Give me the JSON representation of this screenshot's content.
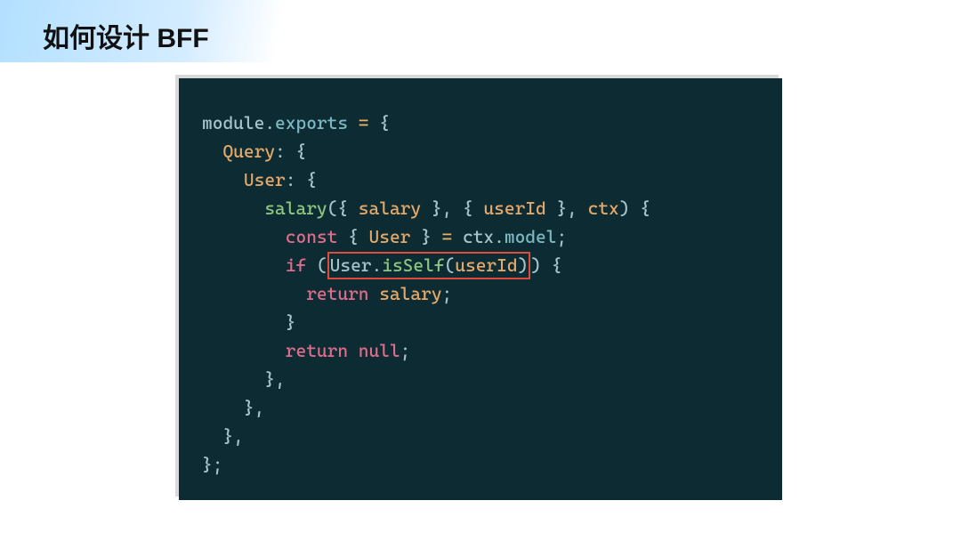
{
  "header": {
    "title_prefix": "如何设计 ",
    "title_bold": "BFF"
  },
  "code": {
    "lines": [
      {
        "indent": 0,
        "segments": [
          {
            "t": "module",
            "c": "tok-obj"
          },
          {
            "t": ".",
            "c": "tok-obj"
          },
          {
            "t": "exports",
            "c": "tok-prop"
          },
          {
            "t": " ",
            "c": ""
          },
          {
            "t": "=",
            "c": "tok-equals"
          },
          {
            "t": " {",
            "c": "tok-brace"
          }
        ]
      },
      {
        "indent": 1,
        "segments": [
          {
            "t": "Query",
            "c": "tok-key"
          },
          {
            "t": ": {",
            "c": "tok-brace"
          }
        ]
      },
      {
        "indent": 2,
        "segments": [
          {
            "t": "User",
            "c": "tok-key"
          },
          {
            "t": ": {",
            "c": "tok-brace"
          }
        ]
      },
      {
        "indent": 3,
        "segments": [
          {
            "t": "salary",
            "c": "tok-method"
          },
          {
            "t": "({ ",
            "c": "tok-brace"
          },
          {
            "t": "salary",
            "c": "tok-param"
          },
          {
            "t": " }, { ",
            "c": "tok-brace"
          },
          {
            "t": "userId",
            "c": "tok-param"
          },
          {
            "t": " }, ",
            "c": "tok-brace"
          },
          {
            "t": "ctx",
            "c": "tok-param"
          },
          {
            "t": ") {",
            "c": "tok-brace"
          }
        ]
      },
      {
        "indent": 4,
        "segments": [
          {
            "t": "const",
            "c": "tok-const"
          },
          {
            "t": " { ",
            "c": "tok-brace"
          },
          {
            "t": "User",
            "c": "tok-var"
          },
          {
            "t": " } ",
            "c": "tok-brace"
          },
          {
            "t": "=",
            "c": "tok-equals"
          },
          {
            "t": " ",
            "c": ""
          },
          {
            "t": "ctx",
            "c": "tok-obj"
          },
          {
            "t": ".",
            "c": "tok-obj"
          },
          {
            "t": "model",
            "c": "tok-prop"
          },
          {
            "t": ";",
            "c": "tok-brace"
          }
        ]
      },
      {
        "indent": 4,
        "segments": [
          {
            "t": "if",
            "c": "tok-kw"
          },
          {
            "t": " (",
            "c": "tok-brace"
          },
          {
            "highlight_start": true
          },
          {
            "t": "User",
            "c": "tok-obj"
          },
          {
            "t": ".",
            "c": "tok-obj"
          },
          {
            "t": "isSelf",
            "c": "tok-call"
          },
          {
            "t": "(",
            "c": "tok-brace"
          },
          {
            "t": "userId",
            "c": "tok-param"
          },
          {
            "t": ")",
            "c": "tok-brace"
          },
          {
            "highlight_end": true
          },
          {
            "t": ") {",
            "c": "tok-brace"
          }
        ]
      },
      {
        "indent": 5,
        "segments": [
          {
            "t": "return",
            "c": "tok-kw"
          },
          {
            "t": " ",
            "c": ""
          },
          {
            "t": "salary",
            "c": "tok-param"
          },
          {
            "t": ";",
            "c": "tok-brace"
          }
        ]
      },
      {
        "indent": 4,
        "segments": [
          {
            "t": "}",
            "c": "tok-brace"
          }
        ]
      },
      {
        "indent": 4,
        "segments": [
          {
            "t": "return",
            "c": "tok-kw"
          },
          {
            "t": " ",
            "c": ""
          },
          {
            "t": "null",
            "c": "tok-null"
          },
          {
            "t": ";",
            "c": "tok-brace"
          }
        ]
      },
      {
        "indent": 3,
        "segments": [
          {
            "t": "},",
            "c": "tok-brace"
          }
        ]
      },
      {
        "indent": 2,
        "segments": [
          {
            "t": "},",
            "c": "tok-brace"
          }
        ]
      },
      {
        "indent": 1,
        "segments": [
          {
            "t": "},",
            "c": "tok-brace"
          }
        ]
      },
      {
        "indent": 0,
        "segments": [
          {
            "t": "};",
            "c": "tok-brace"
          }
        ]
      }
    ]
  }
}
